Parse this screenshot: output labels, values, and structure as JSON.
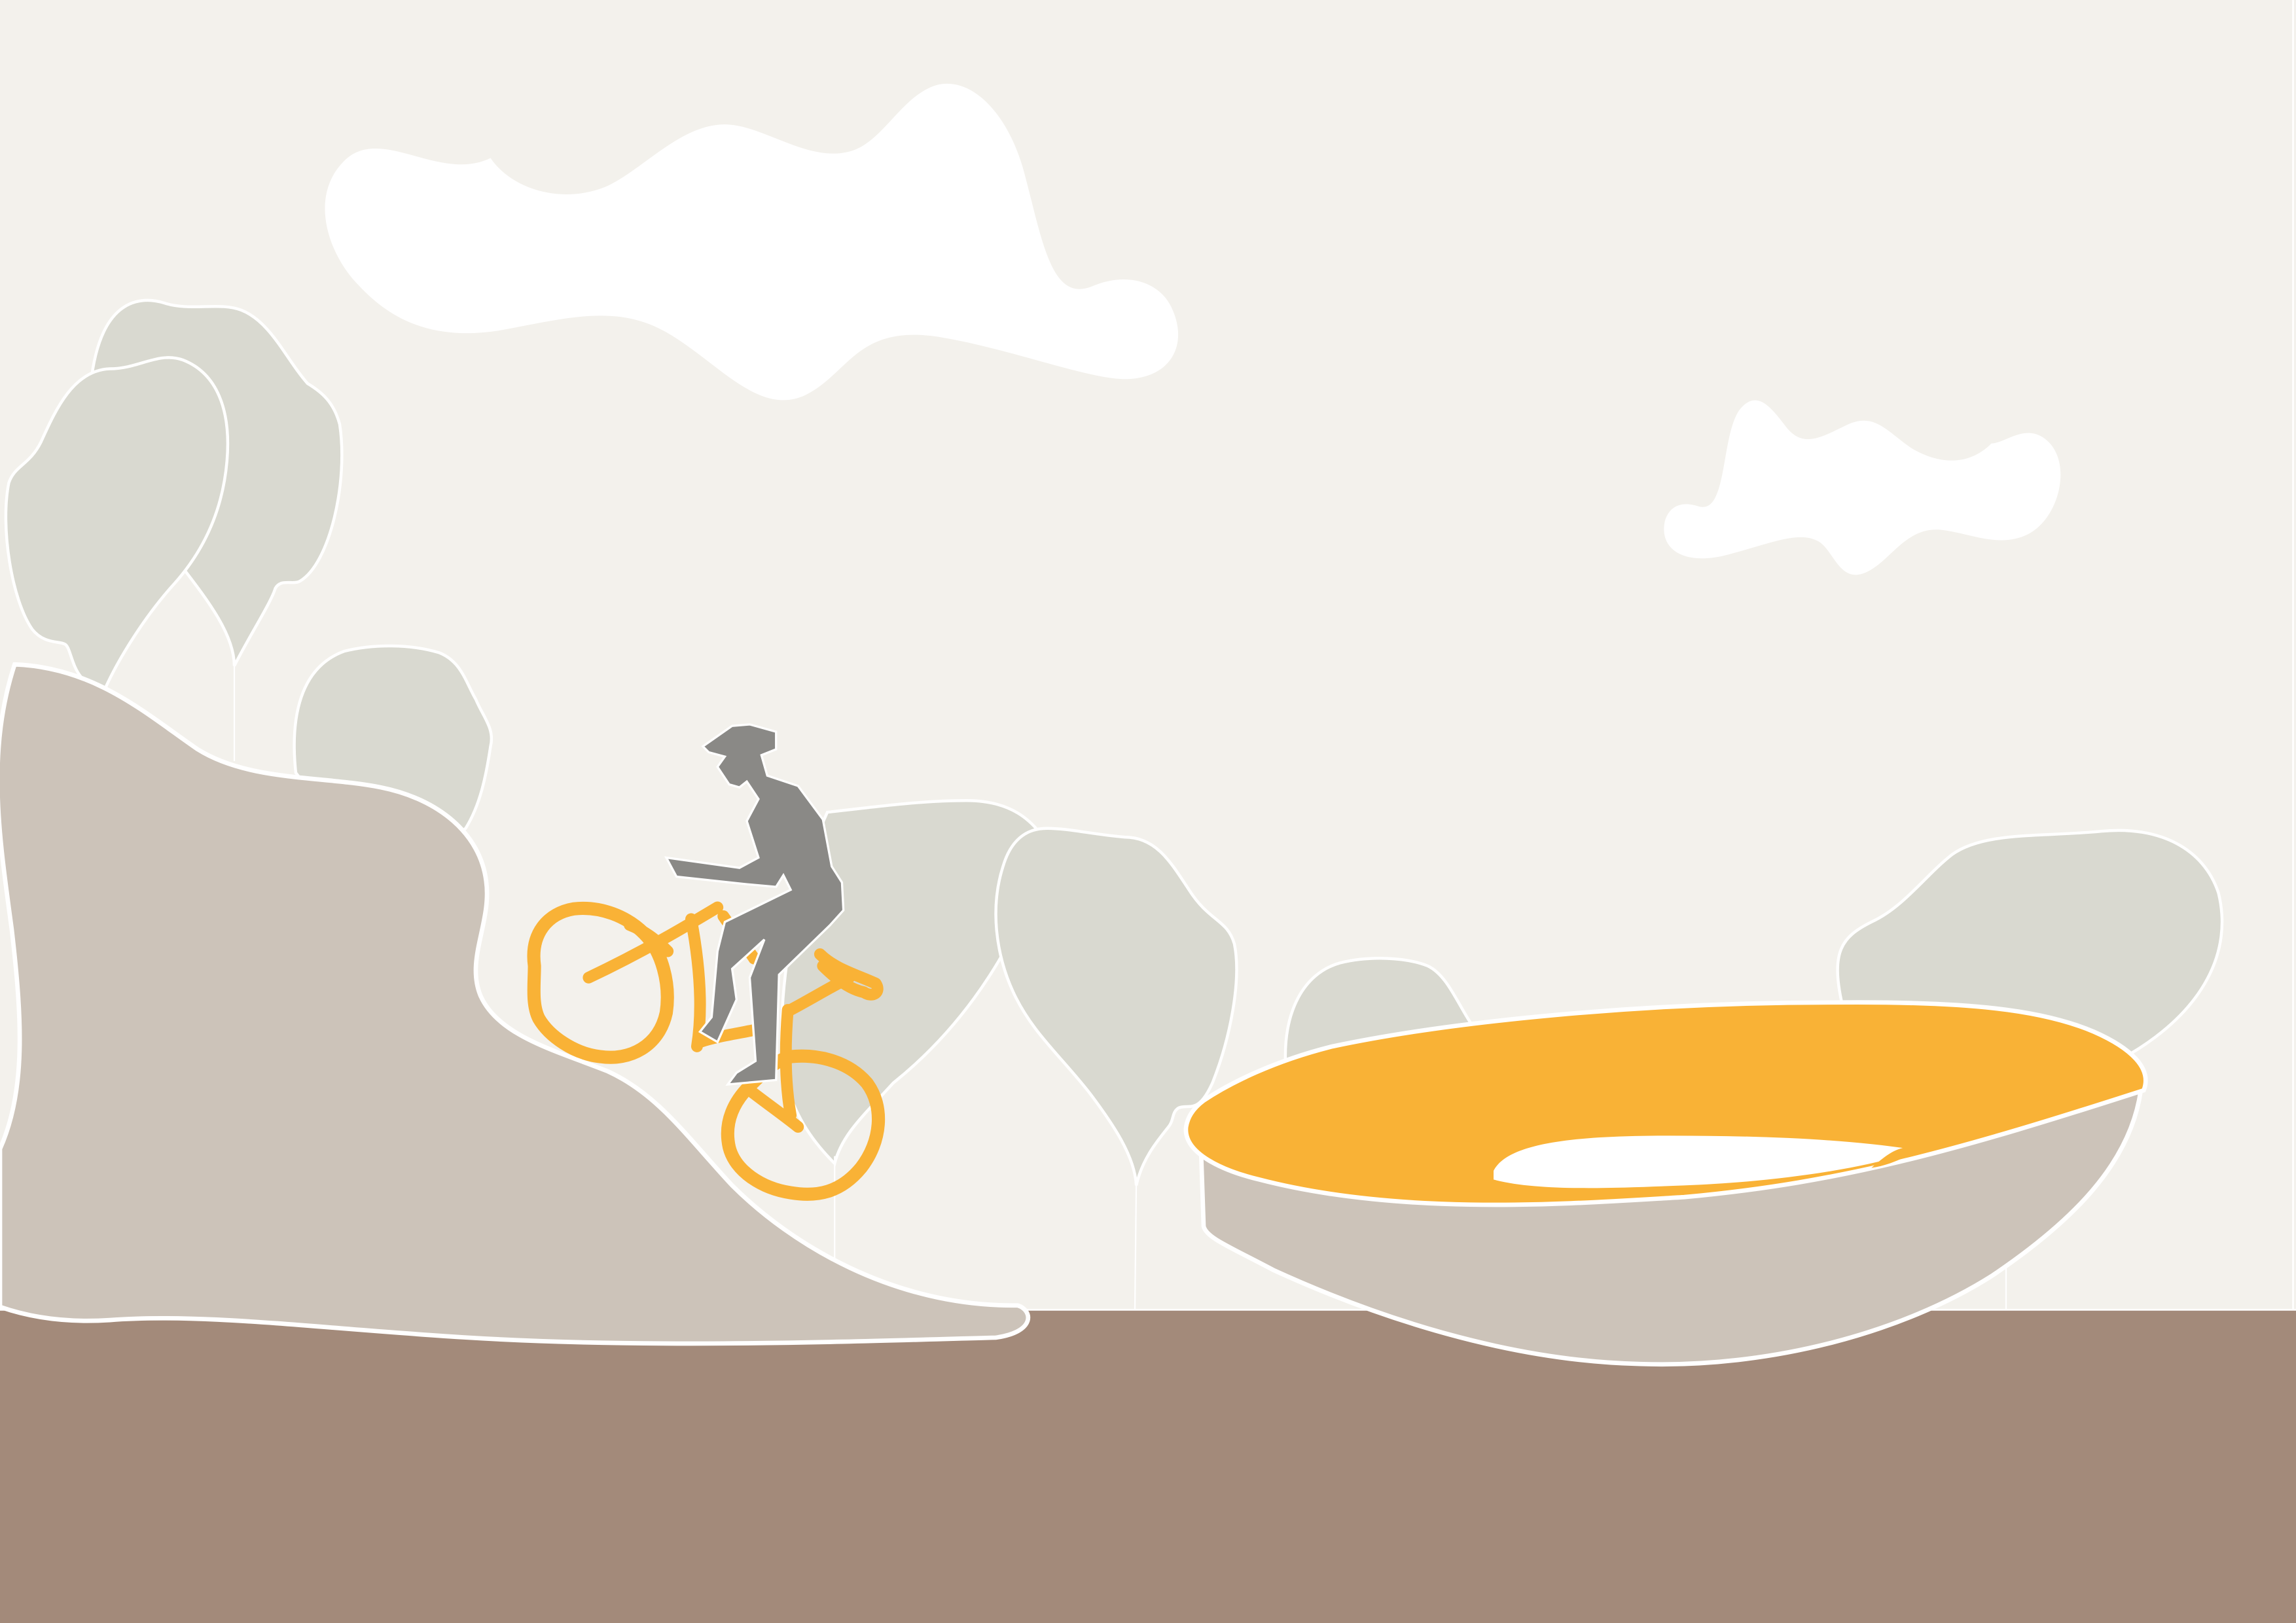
{
  "scene": {
    "description_visible_text": "",
    "colors": {
      "sky": "#f3f1ec",
      "ground": "#a38a7a",
      "hill": "#ccc3b9",
      "tree": "#d9d9d0",
      "cloud": "#ffffff",
      "outline": "#ffffff",
      "accent": "#f9b236",
      "rider": "#8a8986"
    },
    "elements": [
      {
        "name": "sky",
        "kind": "background"
      },
      {
        "name": "cloud",
        "count": 2
      },
      {
        "name": "tree",
        "count": 7
      },
      {
        "name": "left-hill"
      },
      {
        "name": "ground-strip"
      },
      {
        "name": "ramp-bowl"
      },
      {
        "name": "cyclist"
      }
    ]
  }
}
